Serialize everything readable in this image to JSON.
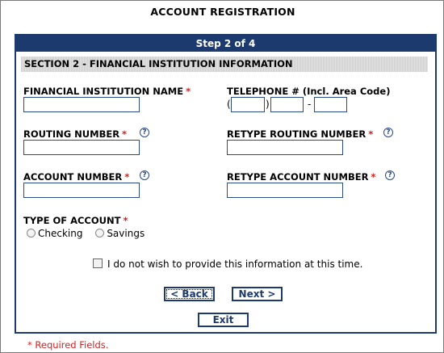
{
  "page": {
    "title": "ACCOUNT REGISTRATION",
    "step": "Step 2 of 4",
    "section": "SECTION 2 - FINANCIAL INSTITUTION INFORMATION",
    "required_marker": "*",
    "required_note": "* Required Fields."
  },
  "fields": {
    "institution_name": {
      "label": "FINANCIAL INSTITUTION NAME",
      "value": ""
    },
    "telephone": {
      "label": "TELEPHONE # (Incl. Area Code)",
      "open_paren": "(",
      "close_paren": ")",
      "dash": "-",
      "area": "",
      "prefix": "",
      "line": ""
    },
    "routing": {
      "label": "ROUTING NUMBER",
      "value": ""
    },
    "retype_routing": {
      "label": "RETYPE ROUTING NUMBER",
      "value": ""
    },
    "account": {
      "label": "ACCOUNT NUMBER",
      "value": ""
    },
    "retype_account": {
      "label": "RETYPE ACCOUNT NUMBER",
      "value": ""
    },
    "account_type": {
      "label": "TYPE OF ACCOUNT",
      "options": [
        "Checking",
        "Savings"
      ],
      "selected": null
    }
  },
  "help_icon_glyph": "?",
  "opt_out": {
    "label": "I do not wish to provide this information at this time.",
    "checked": false
  },
  "buttons": {
    "back": "< Back",
    "next": "Next >",
    "exit": "Exit"
  },
  "colors": {
    "navy": "#1d3a6e",
    "required": "#d61f1f"
  }
}
